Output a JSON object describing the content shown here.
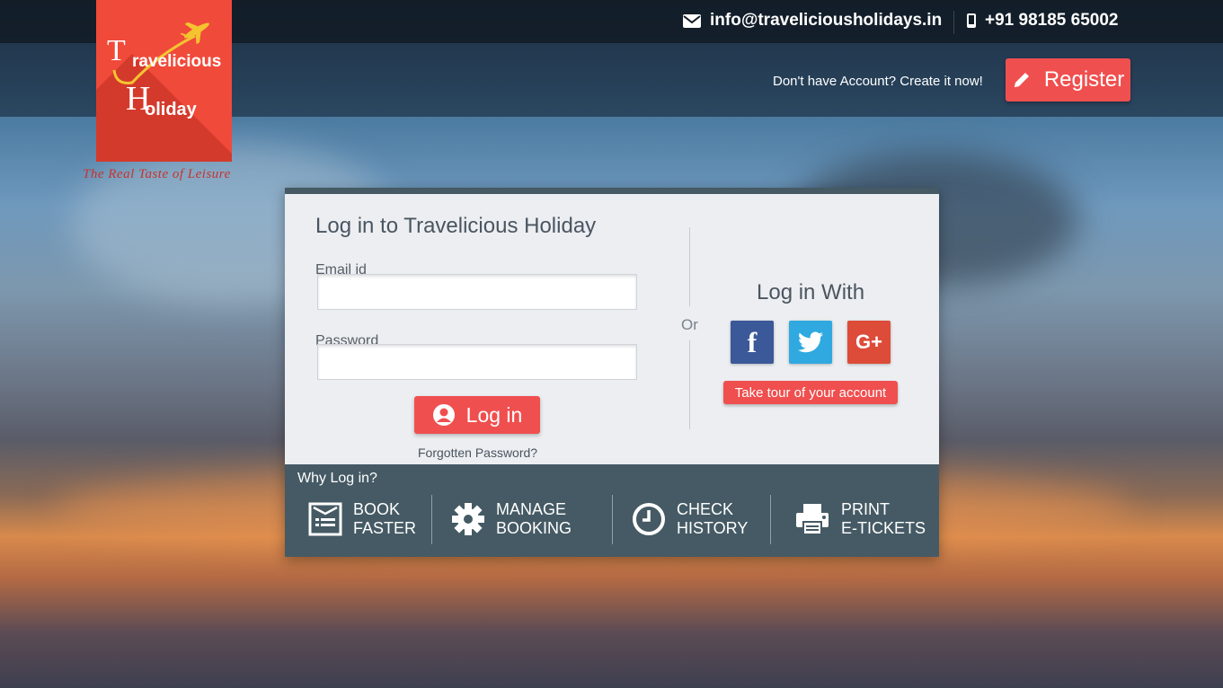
{
  "contact": {
    "email": "info@traveliciousholidays.in",
    "phone": "+91 98185 65002",
    "email_icon": "envelope-icon",
    "phone_icon": "mobile-phone-icon"
  },
  "logo": {
    "line1_initial": "T",
    "line1_word": "ravelicious",
    "line2_initial": "H",
    "line2_word": "oliday",
    "tagline": "The Real Taste of Leisure",
    "icon": "airplane-icon",
    "color": "#f04a3a"
  },
  "header": {
    "account_prompt": "Don't have Account? Create it now!",
    "register_label": "Register",
    "register_icon": "pencil-icon"
  },
  "login": {
    "title": "Log in to Travelicious Holiday",
    "email_label": "Email id",
    "email_value": "",
    "password_label": "Password",
    "password_value": "",
    "login_label": "Log in",
    "login_icon": "user-circle-icon",
    "forgot_label": "Forgotten Password?",
    "or_label": "Or"
  },
  "social": {
    "title": "Log in With",
    "facebook_glyph": "f",
    "google_glyph": "G+",
    "tour_label": "Take tour of your account",
    "colors": {
      "facebook": "#3b5998",
      "twitter": "#2fa9e0",
      "google": "#dd4b39"
    }
  },
  "why": {
    "title": "Why Log in?",
    "features": [
      {
        "line1": "BOOK",
        "line2": "FASTER",
        "icon": "booking-form-icon"
      },
      {
        "line1": "MANAGE",
        "line2": "BOOKING",
        "icon": "gear-icon"
      },
      {
        "line1": "CHECK",
        "line2": "HISTORY",
        "icon": "clock-icon"
      },
      {
        "line1": "PRINT",
        "line2": "E-TICKETS",
        "icon": "printer-icon"
      }
    ]
  },
  "colors": {
    "accent": "#f04f4f",
    "footer_band": "#455a64",
    "panel_bg": "#eceef1"
  }
}
